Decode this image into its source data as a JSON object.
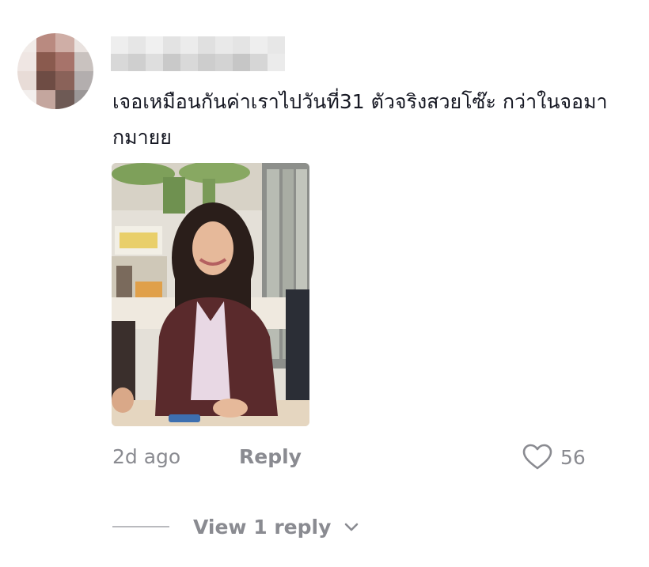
{
  "comment": {
    "text": "เจอเหมือนกันค่าเราไปวันที่31 ตัวจริงสวยโซ๊ะ กว่าในจอมากมายย",
    "timestamp": "2d ago",
    "reply_label": "Reply",
    "like_count": "56",
    "view_replies_label": "View 1 reply"
  },
  "icons": {
    "like": "heart-outline-icon",
    "expand": "chevron-down-icon"
  },
  "colors": {
    "text": "#161823",
    "muted": "#8a8b91"
  }
}
